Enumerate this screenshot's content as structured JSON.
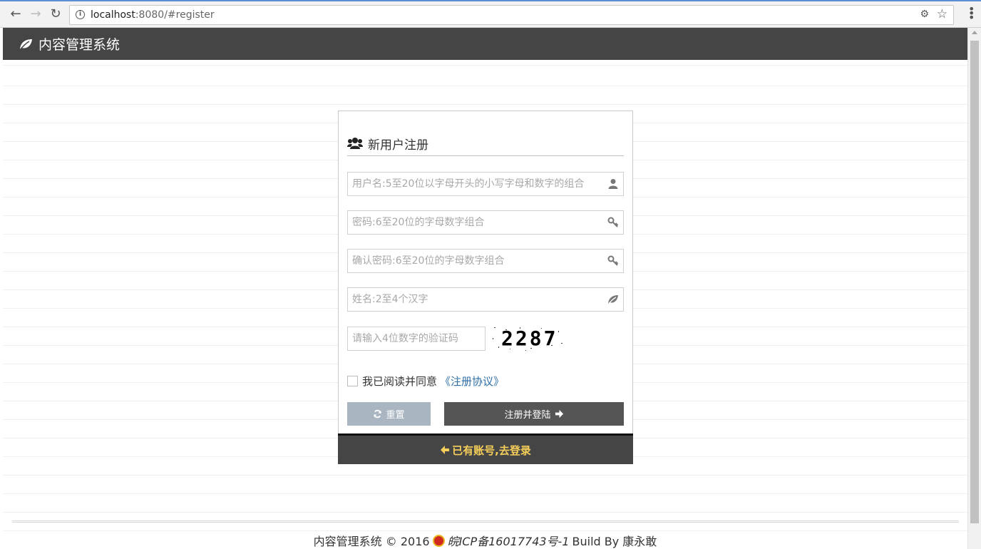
{
  "browser": {
    "url_host": "localhost",
    "url_rest": ":8080/#register"
  },
  "navbar": {
    "brand": "内容管理系统"
  },
  "register": {
    "title": "新用户注册",
    "username_placeholder": "用户名:5至20位以字母开头的小写字母和数字的组合",
    "password_placeholder": "密码:6至20位的字母数字组合",
    "confirm_placeholder": "确认密码:6至20位的字母数字组合",
    "name_placeholder": "姓名:2至4个汉字",
    "captcha_placeholder": "请输入4位数字的验证码",
    "captcha_code": "2287",
    "agree_text": "我已阅读并同意",
    "agree_link": "《注册协议》",
    "reset_label": "重置",
    "submit_label": "注册并登陆",
    "login_link": "已有账号,去登录"
  },
  "footer": {
    "prefix": "内容管理系统 © 2016",
    "icp": "皖ICP备16017743号-1",
    "suffix": "Build By 康永敢"
  },
  "icons": {
    "brand": "leaf-icon",
    "title": "users-icon",
    "username": "user-icon",
    "password": "key-icon",
    "confirm": "key-icon",
    "name": "leaf-icon",
    "reset": "refresh-icon",
    "submit": "arrow-right-icon",
    "login": "arrow-left-icon"
  },
  "colors": {
    "topbar": "#454545",
    "reset_button": "#a9b6c2",
    "submit_button": "#555555",
    "login_link": "#f5cf5a",
    "agree_link": "#2f6fa5"
  }
}
